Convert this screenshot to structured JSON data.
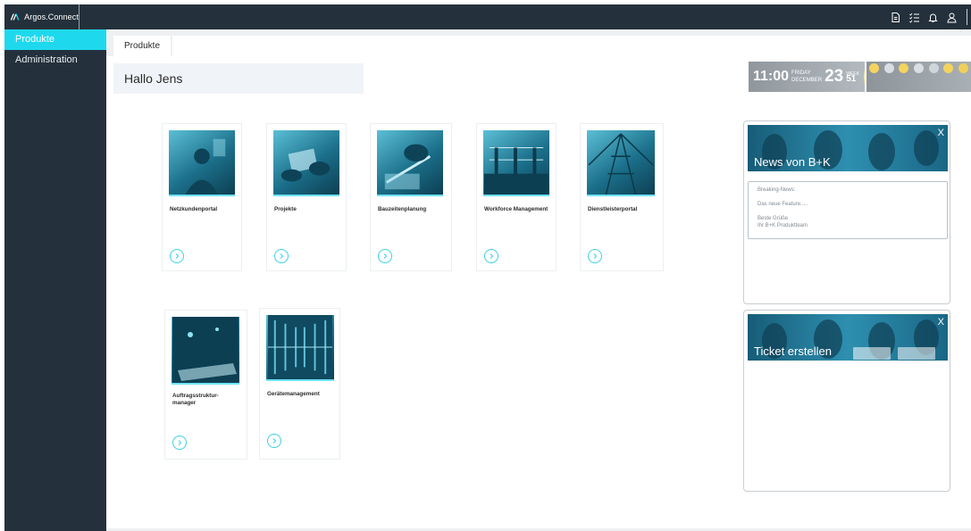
{
  "app": {
    "brand": "Argos.Connect"
  },
  "topbar": {
    "icons": [
      "document-icon",
      "checklist-icon",
      "bell-icon",
      "user-icon"
    ]
  },
  "sidebar": {
    "items": [
      {
        "label": "Produkte",
        "active": true
      },
      {
        "label": "Administration",
        "active": false
      }
    ]
  },
  "tabs": [
    {
      "label": "Produkte"
    }
  ],
  "greeting": "Hallo Jens",
  "weather": {
    "time": "11:00",
    "weekday": "FRIDAY",
    "month": "DECEMBER",
    "day": "23",
    "week_label": "WEEK",
    "week": "51"
  },
  "tiles": [
    {
      "label": "Netzkundenportal",
      "icon": "person-photo"
    },
    {
      "label": "Projekte",
      "icon": "hands-document-photo"
    },
    {
      "label": "Bauzeitenplanung",
      "icon": "drawing-photo"
    },
    {
      "label": "Workforce Management",
      "icon": "substation-photo"
    },
    {
      "label": "Dienstleisterportal",
      "icon": "pylon-photo"
    },
    {
      "label": "Auftragsstruktur-manager",
      "icon": "tablet-photo"
    },
    {
      "label": "Gerätemanagement",
      "icon": "server-room-photo"
    }
  ],
  "news": {
    "title": "News von B+K",
    "close": "X",
    "lines": [
      "Breaking-News:",
      "Das neue Feature.....",
      "Beste Grüße",
      "Ihr B+K Produktteam"
    ]
  },
  "ticket": {
    "title": "Ticket erstellen",
    "close": "X"
  },
  "colors": {
    "sidebar_bg": "#24313c",
    "accent": "#1ed9ee",
    "tile_image": "#1b6f8a"
  }
}
